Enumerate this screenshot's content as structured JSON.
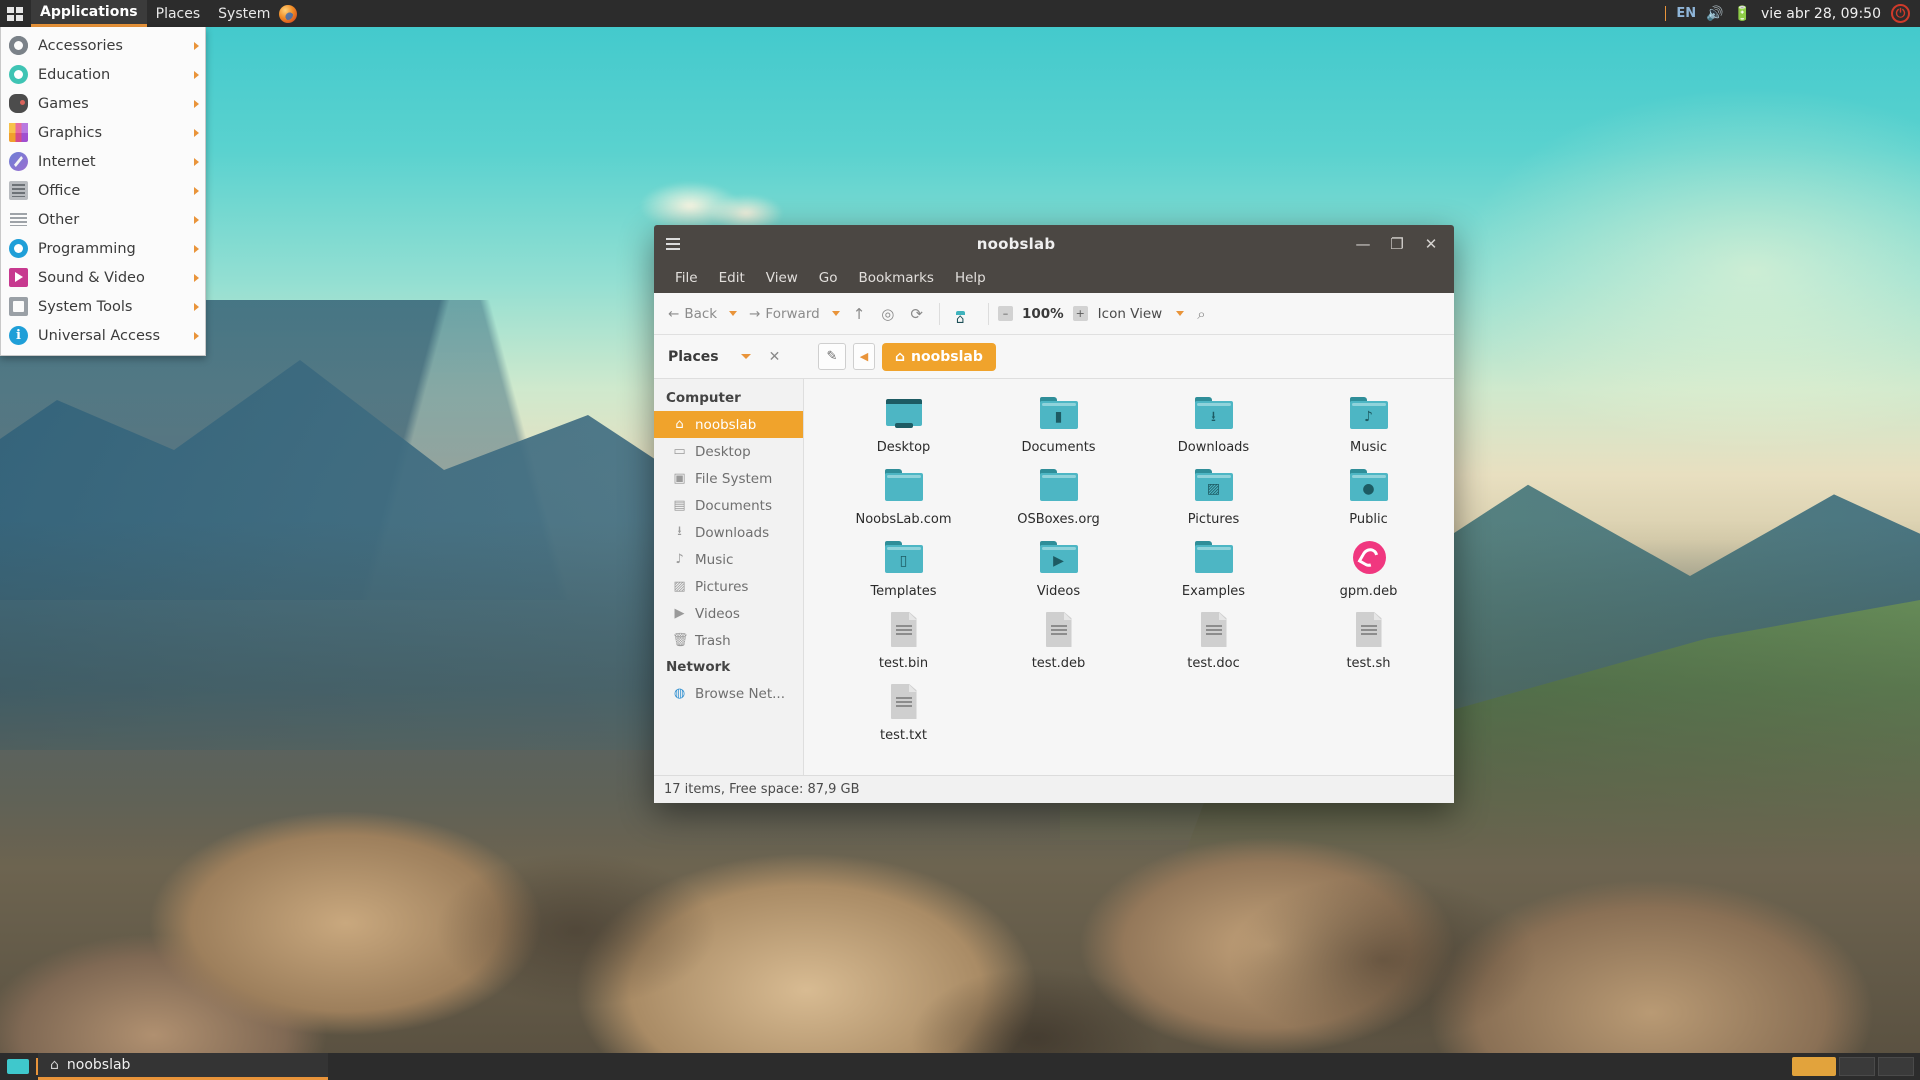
{
  "top_panel": {
    "grid_icon": "apps-grid-icon",
    "menus": [
      "Applications",
      "Places",
      "System"
    ],
    "firefox_icon": "firefox-icon",
    "tray": {
      "language": "EN",
      "volume_icon": "volume-icon",
      "battery_icon": "battery-icon",
      "clock": "vie abr 28, 09:50",
      "power_icon": "power-icon",
      "power_glyph": "⏻"
    }
  },
  "apps_menu": {
    "items": [
      {
        "label": "Accessories",
        "icon": "gear-icon",
        "icon_class": "ico-gear",
        "has_submenu": true
      },
      {
        "label": "Education",
        "icon": "education-icon",
        "icon_class": "ico-edu",
        "has_submenu": true
      },
      {
        "label": "Games",
        "icon": "gamepad-icon",
        "icon_class": "ico-games",
        "has_submenu": true
      },
      {
        "label": "Graphics",
        "icon": "graphics-icon",
        "icon_class": "ico-graphics",
        "has_submenu": true
      },
      {
        "label": "Internet",
        "icon": "compass-icon",
        "icon_class": "ico-internet",
        "has_submenu": true
      },
      {
        "label": "Office",
        "icon": "document-icon",
        "icon_class": "ico-office",
        "has_submenu": true
      },
      {
        "label": "Other",
        "icon": "list-icon",
        "icon_class": "ico-other",
        "has_submenu": true
      },
      {
        "label": "Programming",
        "icon": "disc-icon",
        "icon_class": "ico-prog",
        "has_submenu": true
      },
      {
        "label": "Sound & Video",
        "icon": "play-icon",
        "icon_class": "ico-sound",
        "has_submenu": true
      },
      {
        "label": "System Tools",
        "icon": "system-tools-icon",
        "icon_class": "ico-systools",
        "has_submenu": true
      },
      {
        "label": "Universal Access",
        "icon": "accessibility-icon",
        "icon_class": "ico-access",
        "has_submenu": true,
        "glyph": "i"
      }
    ]
  },
  "file_manager": {
    "title": "noobslab",
    "hamburger_icon": "hamburger-menu-icon",
    "window_controls": {
      "minimize": "—",
      "maximize": "❐",
      "close": "✕"
    },
    "menubar": [
      "File",
      "Edit",
      "View",
      "Go",
      "Bookmarks",
      "Help"
    ],
    "toolbar": {
      "back_label": "Back",
      "forward_label": "Forward",
      "up_icon": "arrow-up-icon",
      "up_glyph": "↑",
      "home_target_icon": "target-icon",
      "home_target_glyph": "◎",
      "reload_icon": "reload-icon",
      "reload_glyph": "⟳",
      "home_folder_icon": "home-folder-icon",
      "device_icon": "device-icon",
      "zoom_out_glyph": "–",
      "zoom_level": "100%",
      "zoom_in_glyph": "+",
      "view_mode": "Icon View",
      "search_icon": "search-icon",
      "search_glyph": "⌕"
    },
    "pathbar": {
      "places_label": "Places",
      "close_icon": "close-icon",
      "close_glyph": "✕",
      "edit_path_icon": "pencil-icon",
      "edit_path_glyph": "✎",
      "back_chevron_glyph": "◀",
      "crumb_home_glyph": "⌂",
      "crumb_label": "noobslab"
    },
    "sidebar": {
      "sections": [
        {
          "header": "Computer",
          "items": [
            {
              "label": "noobslab",
              "icon": "home-icon",
              "glyph": "⌂",
              "active": true
            },
            {
              "label": "Desktop",
              "icon": "desktop-icon",
              "glyph": "▭",
              "active": false
            },
            {
              "label": "File System",
              "icon": "filesystem-icon",
              "glyph": "▣",
              "active": false
            },
            {
              "label": "Documents",
              "icon": "document-icon",
              "glyph": "▤",
              "active": false
            },
            {
              "label": "Downloads",
              "icon": "download-icon",
              "glyph": "⭳",
              "active": false
            },
            {
              "label": "Music",
              "icon": "music-note-icon",
              "glyph": "♪",
              "active": false
            },
            {
              "label": "Pictures",
              "icon": "picture-icon",
              "glyph": "▨",
              "active": false
            },
            {
              "label": "Videos",
              "icon": "video-camera-icon",
              "glyph": "▶",
              "active": false
            },
            {
              "label": "Trash",
              "icon": "trash-icon",
              "glyph": "🗑",
              "active": false
            }
          ]
        },
        {
          "header": "Network",
          "items": [
            {
              "label": "Browse Net...",
              "icon": "globe-icon",
              "glyph": "◍",
              "active": false
            }
          ]
        }
      ]
    },
    "files": [
      {
        "label": "Desktop",
        "kind": "monitor",
        "emblem": ""
      },
      {
        "label": "Documents",
        "kind": "folder",
        "emblem": "▮"
      },
      {
        "label": "Downloads",
        "kind": "folder",
        "emblem": "⭳"
      },
      {
        "label": "Music",
        "kind": "folder",
        "emblem": "♪"
      },
      {
        "label": "NoobsLab.com",
        "kind": "folder",
        "emblem": ""
      },
      {
        "label": "OSBoxes.org",
        "kind": "folder",
        "emblem": ""
      },
      {
        "label": "Pictures",
        "kind": "folder",
        "emblem": "▨"
      },
      {
        "label": "Public",
        "kind": "folder",
        "emblem": "●"
      },
      {
        "label": "Templates",
        "kind": "folder",
        "emblem": "▯"
      },
      {
        "label": "Videos",
        "kind": "folder",
        "emblem": "▶"
      },
      {
        "label": "Examples",
        "kind": "folder",
        "emblem": ""
      },
      {
        "label": "gpm.deb",
        "kind": "deb",
        "emblem": ""
      },
      {
        "label": "test.bin",
        "kind": "doc",
        "emblem": ""
      },
      {
        "label": "test.deb",
        "kind": "doc",
        "emblem": ""
      },
      {
        "label": "test.doc",
        "kind": "doc",
        "emblem": ""
      },
      {
        "label": "test.sh",
        "kind": "doc",
        "emblem": ""
      },
      {
        "label": "test.txt",
        "kind": "doc",
        "emblem": ""
      }
    ],
    "status": "17 items, Free space: 87,9 GB"
  },
  "bottom_panel": {
    "show_desktop_icon": "show-desktop-icon",
    "task": {
      "home_icon": "home-icon",
      "home_glyph": "⌂",
      "label": "noobslab"
    }
  },
  "colors": {
    "accent_orange": "#f0a32c",
    "panel_dark": "#2c2c2c",
    "titlebar": "#4b4743",
    "folder_teal": "#4db6c4",
    "deb_pink": "#f0377f"
  }
}
